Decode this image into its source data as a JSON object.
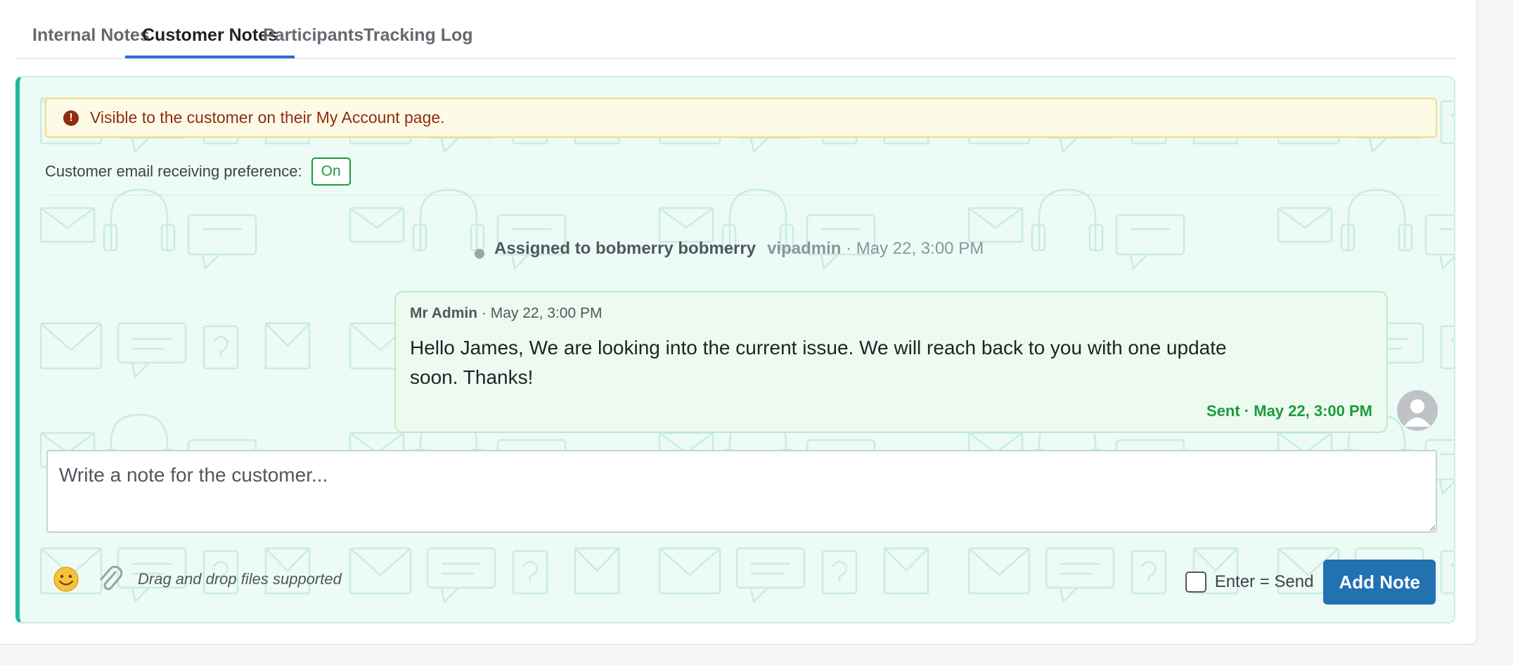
{
  "tabs": [
    {
      "label": "Internal Notes",
      "active": false
    },
    {
      "label": "Customer Notes",
      "active": true
    },
    {
      "label": "Participants",
      "active": false
    },
    {
      "label": "Tracking Log",
      "active": false
    }
  ],
  "notice": {
    "icon": "exclamation-circle-icon",
    "text": "Visible to the customer on their My Account page."
  },
  "preference": {
    "label": "Customer email receiving preference:",
    "value": "On"
  },
  "event": {
    "text": "Assigned to bobmerry bobmerry",
    "user": "vipadmin",
    "time": "· May 22, 3:00 PM"
  },
  "message": {
    "author": "Mr Admin",
    "time": "· May 22, 3:00 PM",
    "body": "Hello James, We are looking into the current issue. We will reach back to you with one update soon. Thanks!",
    "status": "Sent · May 22, 3:00 PM"
  },
  "composer": {
    "placeholder": "Write a note for the customer...",
    "drag_text": "Drag and drop files supported",
    "enter_send_label": "Enter = Send",
    "submit_label": "Add Note"
  },
  "colors": {
    "accent": "#2271b1",
    "tab_underline": "#2c6dd6",
    "panel_bg": "#ecfbf6",
    "panel_border_left": "#1fb99b",
    "notice_bg": "#fdfbe6",
    "notice_text": "#8f2c13",
    "success": "#1c9a3e"
  }
}
